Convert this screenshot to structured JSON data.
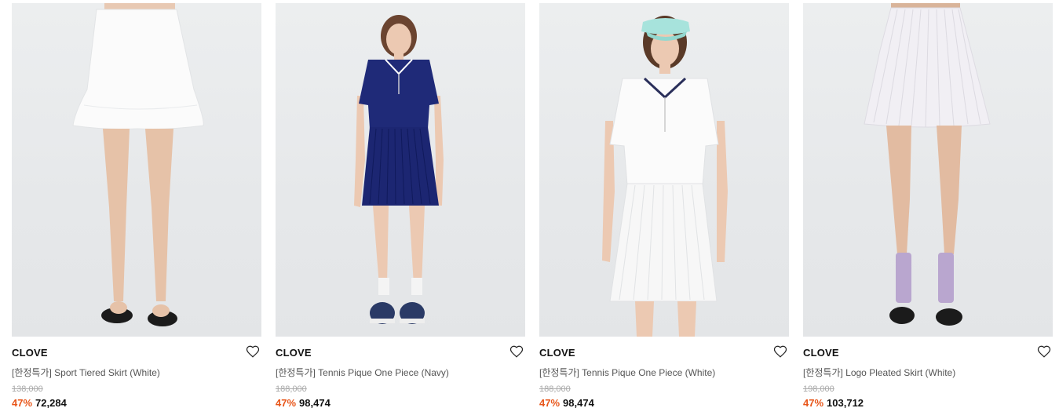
{
  "products": [
    {
      "brand": "CLOVE",
      "name": "[한정특가] Sport Tiered Skirt (White)",
      "original_price": "138,000",
      "discount": "47%",
      "price": "72,284",
      "image": "white-skirt-flip-flops"
    },
    {
      "brand": "CLOVE",
      "name": "[한정특가] Tennis Pique One Piece (Navy)",
      "original_price": "188,000",
      "discount": "47%",
      "price": "98,474",
      "image": "navy-polo-dress"
    },
    {
      "brand": "CLOVE",
      "name": "[한정특가] Tennis Pique One Piece (White)",
      "original_price": "188,000",
      "discount": "47%",
      "price": "98,474",
      "image": "white-polo-dress-visor"
    },
    {
      "brand": "CLOVE",
      "name": "[한정특가] Logo Pleated Skirt (White)",
      "original_price": "198,000",
      "discount": "47%",
      "price": "103,712",
      "image": "pleated-skirt-lavender-socks"
    }
  ],
  "icons": {
    "wishlist": "heart-outline-icon"
  },
  "colors": {
    "discount": "#e8561a",
    "strike": "#aaaaaa",
    "brand": "#111111",
    "name": "#555555"
  }
}
